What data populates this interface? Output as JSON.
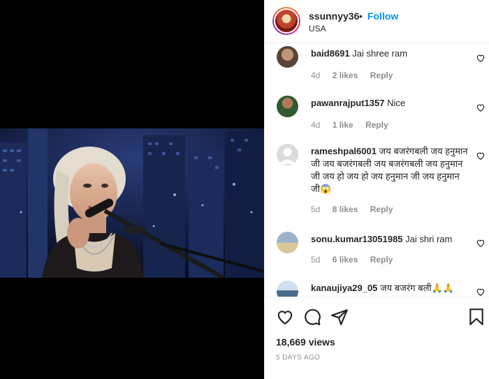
{
  "post": {
    "username": "ssunnyy36",
    "separator": "•",
    "follow_label": "Follow",
    "location": "USA",
    "more_icon": "more-horizontal-icon"
  },
  "comments": [
    {
      "username": "baid8691",
      "text": "Jai shree ram",
      "age": "4d",
      "likes": "2 likes",
      "reply": "Reply"
    },
    {
      "username": "pawanrajput1357",
      "text": "Nice",
      "age": "4d",
      "likes": "1 like",
      "reply": "Reply"
    },
    {
      "username": "rameshpal6001",
      "text": "जय बजरंगबली जय हनुमान जी जय बजरंगबली जय बजरंगबली जय हनुमान जी जय हो जय हो जय हनुमान जी जय हनुमान जी😱",
      "age": "5d",
      "likes": "8 likes",
      "reply": "Reply"
    },
    {
      "username": "sonu.kumar13051985",
      "text": "Jai shri ram",
      "age": "5d",
      "likes": "6 likes",
      "reply": "Reply"
    },
    {
      "username": "kanaujiya29_05",
      "text": "जय बजरंग बली🙏🙏",
      "age": "",
      "likes": "",
      "reply": ""
    }
  ],
  "actions": {
    "like_icon": "heart-icon",
    "comment_icon": "comment-icon",
    "share_icon": "share-icon",
    "save_icon": "bookmark-icon"
  },
  "stats": {
    "views": "18,669 views",
    "date": "5 DAYS AGO"
  },
  "colors": {
    "accent": "#0095f6",
    "muted": "#8e8e8e",
    "text": "#262626"
  }
}
